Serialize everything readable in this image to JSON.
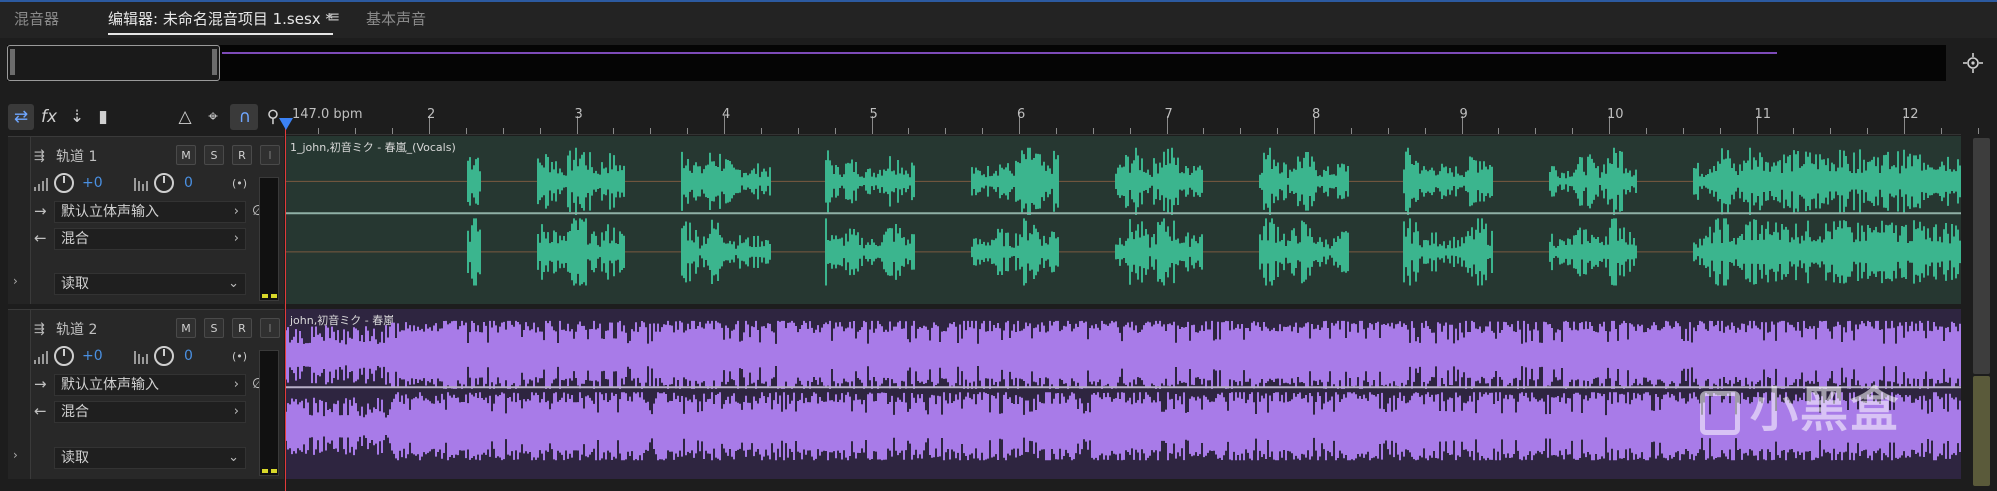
{
  "tabs": [
    {
      "label": "混音器"
    },
    {
      "label": "编辑器: 未命名混音项目 1.sesx *"
    },
    {
      "label": "基本声音"
    }
  ],
  "tab_menu_icon": "hamburger-menu-icon",
  "toolbar": {
    "tools": [
      "loop-icon",
      "fx-icon",
      "sends-icon",
      "eq-icon",
      "metronome-icon",
      "time-select-icon",
      "slip-icon",
      "snap-magnet-icon",
      "marker-icon"
    ]
  },
  "ruler": {
    "bpm_label": "147.0 bpm",
    "beats": [
      "2",
      "3",
      "4",
      "5",
      "6",
      "7",
      "8",
      "9",
      "10",
      "11",
      "12"
    ]
  },
  "tracks": [
    {
      "name": "轨道 1",
      "mute": "M",
      "solo": "S",
      "record": "R",
      "input_monitor": "I",
      "volume": "+0",
      "pan": "0",
      "input": "默认立体声输入",
      "output": "混合",
      "automation": "读取",
      "clip_title": "1_john,初音ミク - 春嵐_(Vocals)",
      "waveform_color": "#3bb58e"
    },
    {
      "name": "轨道 2",
      "mute": "M",
      "solo": "S",
      "record": "R",
      "input_monitor": "I",
      "volume": "+0",
      "pan": "0",
      "input": "默认立体声输入",
      "output": "混合",
      "automation": "读取",
      "clip_title": "john,初音ミク - 春嵐",
      "waveform_color": "#a87be8"
    }
  ],
  "watermark": "小黑盒",
  "colors": {
    "accent": "#4a90e2",
    "playhead": "#e23a3a",
    "overview_wave": "#7d4bb8"
  }
}
